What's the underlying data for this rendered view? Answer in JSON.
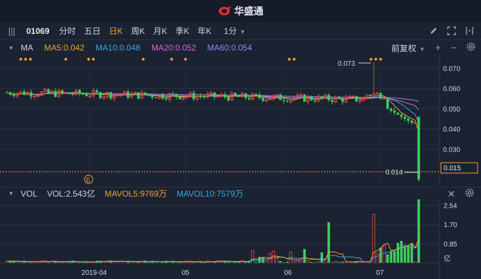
{
  "app": {
    "brand_text": "华盛通"
  },
  "toolbar": {
    "stock_code": "01069",
    "periods": [
      "分时",
      "五日",
      "日K",
      "周K",
      "月K",
      "季K",
      "年K"
    ],
    "active_period": "日K",
    "interval": "1分"
  },
  "indicators": {
    "main_label": "MA",
    "ma5": "MA5:0.042",
    "ma10": "MA10:0.048",
    "ma20": "MA20:0.052",
    "ma60": "MA60:0.054",
    "adjust": "前复权",
    "colors": {
      "ma5": "#f0a030",
      "ma10": "#3aa7e0",
      "ma20": "#d46ad8",
      "ma60": "#9a86f0",
      "up": "#e04646",
      "down": "#3ecf5a",
      "accent": "#f2a93b"
    }
  },
  "volume": {
    "label": "VOL",
    "vol": "VOL:2.543亿",
    "mavol5": "MAVOL5:9769万",
    "mavol10": "MAVOL10:7579万"
  },
  "chart_data": [
    {
      "type": "candlestick",
      "title": "",
      "y_axis_ticks": [
        "0.070",
        "0.060",
        "0.050",
        "0.040",
        "0.030"
      ],
      "ylim": [
        0.012,
        0.077
      ],
      "high_label": "0.073",
      "low_label": "0.014",
      "last_price": "0.015",
      "event_marker": "E",
      "ma": {
        "ma5": 0.042,
        "ma10": 0.048,
        "ma20": 0.052,
        "ma60": 0.054
      }
    },
    {
      "type": "bar",
      "title": "",
      "y_axis_ticks": [
        "2.54",
        "1.70",
        "0.85"
      ],
      "y_unit": "亿",
      "ylim": [
        0,
        2.8
      ],
      "x_ticks": [
        "2019-04",
        "05",
        "06",
        "07"
      ]
    }
  ]
}
